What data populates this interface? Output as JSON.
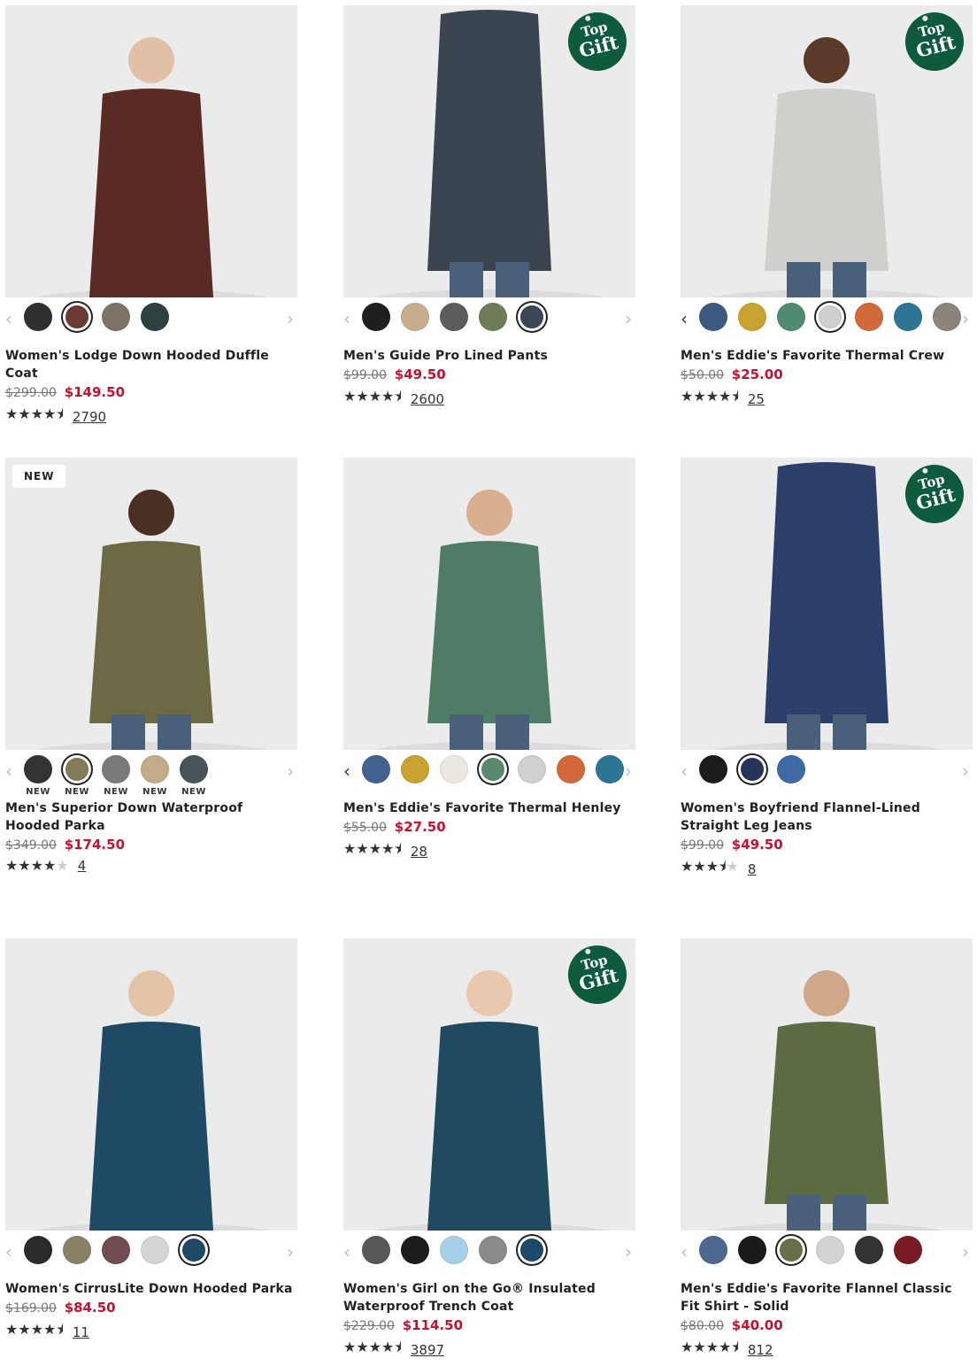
{
  "colors": {
    "sale": "#c8102e",
    "gift_badge": "#0d5a3c"
  },
  "products": [
    {
      "name": "Women's Lodge Down Hooded Duffle Coat",
      "old_price": "$299.00",
      "sale_price": "$149.50",
      "rating": 4.5,
      "reviews": "2790",
      "badge": "",
      "gift": false,
      "swatches": [
        {
          "color": "#2f2f2f",
          "selected": false,
          "label": ""
        },
        {
          "color": "#6b3a33",
          "selected": true,
          "label": ""
        },
        {
          "color": "#7d7366",
          "selected": false,
          "label": ""
        },
        {
          "color": "#2e4140",
          "selected": false,
          "label": ""
        }
      ],
      "left_arrow_active": false
    },
    {
      "name": "Men's Guide Pro Lined Pants",
      "old_price": "$99.00",
      "sale_price": "$49.50",
      "rating": 4.5,
      "reviews": "2600",
      "badge": "",
      "gift": true,
      "swatches": [
        {
          "color": "#1f1f1f",
          "selected": false,
          "label": ""
        },
        {
          "color": "#c8ad8d",
          "selected": false,
          "label": ""
        },
        {
          "color": "#5c5c5c",
          "selected": false,
          "label": ""
        },
        {
          "color": "#6f7c5a",
          "selected": false,
          "label": ""
        },
        {
          "color": "#3b4656",
          "selected": true,
          "label": ""
        }
      ],
      "left_arrow_active": false
    },
    {
      "name": "Men's Eddie's Favorite Thermal Crew",
      "old_price": "$50.00",
      "sale_price": "$25.00",
      "rating": 4.5,
      "reviews": "25",
      "badge": "",
      "gift": true,
      "swatches": [
        {
          "color": "#3d5a80",
          "selected": false,
          "label": ""
        },
        {
          "color": "#c9a22f",
          "selected": false,
          "label": ""
        },
        {
          "color": "#4f8a73",
          "selected": false,
          "label": ""
        },
        {
          "color": "#cfcfcf",
          "selected": true,
          "label": ""
        },
        {
          "color": "#d2693a",
          "selected": false,
          "label": ""
        },
        {
          "color": "#2d7595",
          "selected": false,
          "label": ""
        },
        {
          "color": "#8b847b",
          "selected": false,
          "label": ""
        }
      ],
      "left_arrow_active": true
    },
    {
      "name": "Men's Superior Down Waterproof Hooded Parka",
      "old_price": "$349.00",
      "sale_price": "$174.50",
      "rating": 4,
      "reviews": "4",
      "badge": "NEW",
      "gift": false,
      "swatches": [
        {
          "color": "#333333",
          "selected": false,
          "label": "NEW"
        },
        {
          "color": "#837a58",
          "selected": true,
          "label": "NEW"
        },
        {
          "color": "#7a7a7a",
          "selected": false,
          "label": "NEW"
        },
        {
          "color": "#c2ab88",
          "selected": false,
          "label": "NEW"
        },
        {
          "color": "#47555a",
          "selected": false,
          "label": "NEW"
        }
      ],
      "left_arrow_active": false
    },
    {
      "name": "Men's Eddie's Favorite Thermal Henley",
      "old_price": "$55.00",
      "sale_price": "$27.50",
      "rating": 4.5,
      "reviews": "28",
      "badge": "",
      "gift": false,
      "swatches": [
        {
          "color": "#41618f",
          "selected": false,
          "label": ""
        },
        {
          "color": "#c9a22f",
          "selected": false,
          "label": ""
        },
        {
          "color": "#ece8df",
          "selected": false,
          "label": ""
        },
        {
          "color": "#5a8a6e",
          "selected": true,
          "label": ""
        },
        {
          "color": "#d0d0d0",
          "selected": false,
          "label": ""
        },
        {
          "color": "#d2693a",
          "selected": false,
          "label": ""
        },
        {
          "color": "#2d7595",
          "selected": false,
          "label": ""
        }
      ],
      "left_arrow_active": true
    },
    {
      "name": "Women's Boyfriend Flannel-Lined Straight Leg Jeans",
      "old_price": "$99.00",
      "sale_price": "$49.50",
      "rating": 3.5,
      "reviews": "8",
      "badge": "",
      "gift": true,
      "swatches": [
        {
          "color": "#1c1c1c",
          "selected": false,
          "label": ""
        },
        {
          "color": "#26345a",
          "selected": true,
          "label": ""
        },
        {
          "color": "#3f6aa5",
          "selected": false,
          "label": ""
        }
      ],
      "left_arrow_active": false
    },
    {
      "name": "Women's CirrusLite Down Hooded Parka",
      "old_price": "$169.00",
      "sale_price": "$84.50",
      "rating": 4.5,
      "reviews": "11",
      "badge": "",
      "gift": false,
      "swatches": [
        {
          "color": "#2a2a2a",
          "selected": false,
          "label": ""
        },
        {
          "color": "#8a8066",
          "selected": false,
          "label": ""
        },
        {
          "color": "#6e4c4f",
          "selected": false,
          "label": ""
        },
        {
          "color": "#d5d5d5",
          "selected": false,
          "label": ""
        },
        {
          "color": "#1e4a66",
          "selected": true,
          "label": ""
        }
      ],
      "left_arrow_active": false
    },
    {
      "name": "Women's Girl on the Go® Insulated Waterproof Trench Coat",
      "old_price": "$229.00",
      "sale_price": "$114.50",
      "rating": 4.5,
      "reviews": "3897",
      "badge": "",
      "gift": true,
      "swatches": [
        {
          "color": "#575757",
          "selected": false,
          "label": ""
        },
        {
          "color": "#1c1c1c",
          "selected": false,
          "label": ""
        },
        {
          "color": "#a6cfe8",
          "selected": false,
          "label": ""
        },
        {
          "color": "#8a8a8a",
          "selected": false,
          "label": ""
        },
        {
          "color": "#1d4a6a",
          "selected": true,
          "label": ""
        }
      ],
      "left_arrow_active": false
    },
    {
      "name": "Men's Eddie's Favorite Flannel Classic Fit Shirt - Solid",
      "old_price": "$80.00",
      "sale_price": "$40.00",
      "rating": 4.5,
      "reviews": "812",
      "badge": "",
      "gift": false,
      "swatches": [
        {
          "color": "#4e6891",
          "selected": false,
          "label": ""
        },
        {
          "color": "#1a1a1a",
          "selected": false,
          "label": ""
        },
        {
          "color": "#68704a",
          "selected": true,
          "label": ""
        },
        {
          "color": "#d4d2d0",
          "selected": false,
          "label": ""
        },
        {
          "color": "#333333",
          "selected": false,
          "label": ""
        },
        {
          "color": "#7a1a24",
          "selected": false,
          "label": ""
        }
      ],
      "left_arrow_active": false
    }
  ]
}
